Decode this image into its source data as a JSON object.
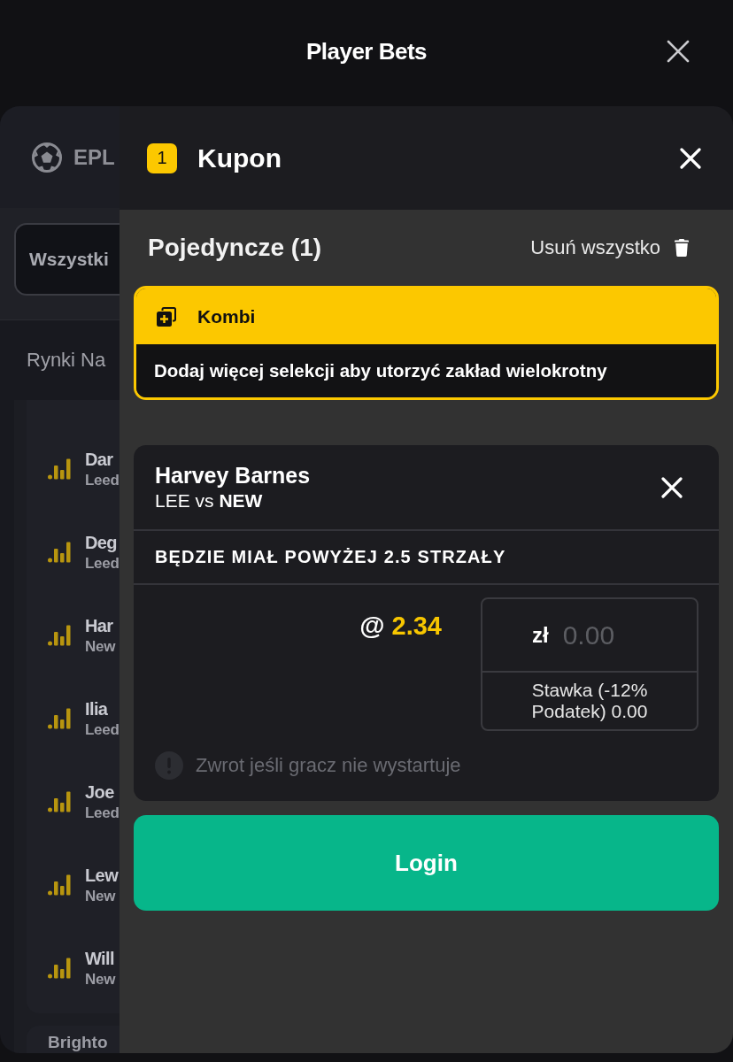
{
  "header": {
    "title": "Player Bets"
  },
  "background": {
    "league": "EPL",
    "filter": "Wszystki",
    "section_title": "Rynki Na",
    "players": [
      {
        "name": "Dar",
        "team": "Leed"
      },
      {
        "name": "Deg",
        "team": "Leed"
      },
      {
        "name": "Har",
        "team": "New"
      },
      {
        "name": "Ilia",
        "team": "Leed"
      },
      {
        "name": "Joe",
        "team": "Leed"
      },
      {
        "name": "Lew",
        "team": "New"
      },
      {
        "name": "Will",
        "team": "New"
      }
    ],
    "next_match": "Brighto"
  },
  "coupon": {
    "count": "1",
    "title": "Kupon",
    "section_title": "Pojedyncze (1)",
    "clear_all": "Usuń wszystko",
    "combo": {
      "title": "Kombi",
      "message": "Dodaj więcej selekcji aby utorzyć zakład wielokrotny"
    },
    "bets": [
      {
        "player": "Harvey Barnes",
        "match": "LEE vs **NEW**",
        "market": "BĘDZIE MIAŁ POWYŻEJ 2.5 STRZAŁY",
        "odds_prefix": "@",
        "odds": "2.34",
        "stake": {
          "currency": "zł",
          "placeholder": "0.00",
          "note": "Stawka (-12% Podatek) 0.00"
        },
        "refund_option": {
          "label": "Zwrot jeśli gracz nie wystartuje",
          "disabled": true
        }
      }
    ],
    "login_button": "Login"
  }
}
